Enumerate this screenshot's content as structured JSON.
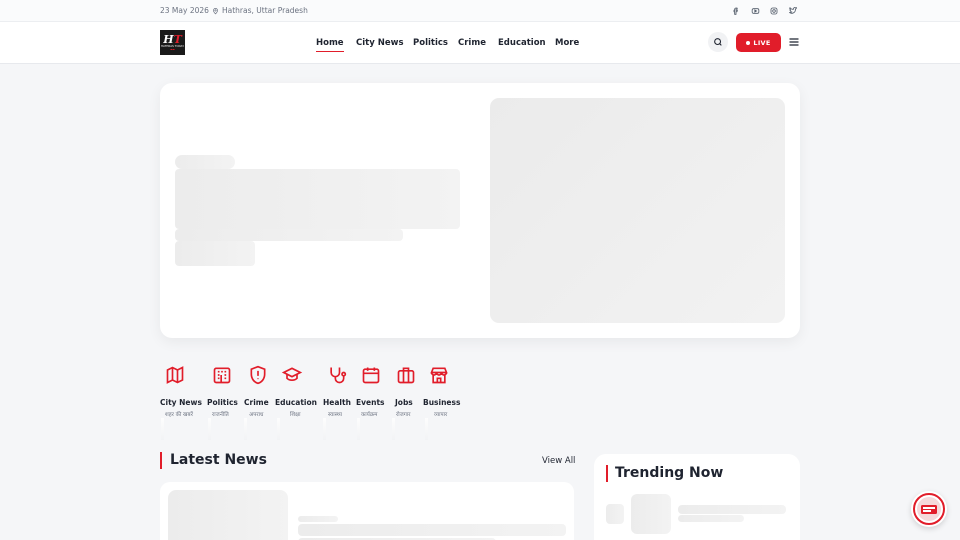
{
  "topbar": {
    "date": "23 May 2026",
    "location": "Hathras, Uttar Pradesh",
    "social": [
      "facebook-icon",
      "youtube-icon",
      "instagram-icon",
      "twitter-icon"
    ]
  },
  "header": {
    "logo": {
      "text": "HATHRAS TODAY"
    },
    "nav": [
      "Home",
      "City News",
      "Politics",
      "Crime",
      "Education",
      "More"
    ],
    "active_nav": "Home",
    "live_label": "LIVE"
  },
  "categories": [
    {
      "en": "City News",
      "hi": "शहर की खबरें",
      "icon": "map-icon"
    },
    {
      "en": "Politics",
      "hi": "राजनीति",
      "icon": "building-icon"
    },
    {
      "en": "Crime",
      "hi": "अपराध",
      "icon": "shield-alert-icon"
    },
    {
      "en": "Education",
      "hi": "शिक्षा",
      "icon": "graduation-cap-icon"
    },
    {
      "en": "Health",
      "hi": "स्वास्थ्य",
      "icon": "stethoscope-icon"
    },
    {
      "en": "Events",
      "hi": "कार्यक्रम",
      "icon": "calendar-icon"
    },
    {
      "en": "Jobs",
      "hi": "रोजगार",
      "icon": "briefcase-icon"
    },
    {
      "en": "Business",
      "hi": "व्यापार",
      "icon": "store-icon"
    }
  ],
  "latest": {
    "title": "Latest News",
    "view_all": "View All"
  },
  "trending": {
    "title": "Trending Now"
  },
  "colors": {
    "accent": "#e11d2a",
    "text": "#1f2430",
    "muted": "#6b7280",
    "background": "#f5f6f8"
  }
}
